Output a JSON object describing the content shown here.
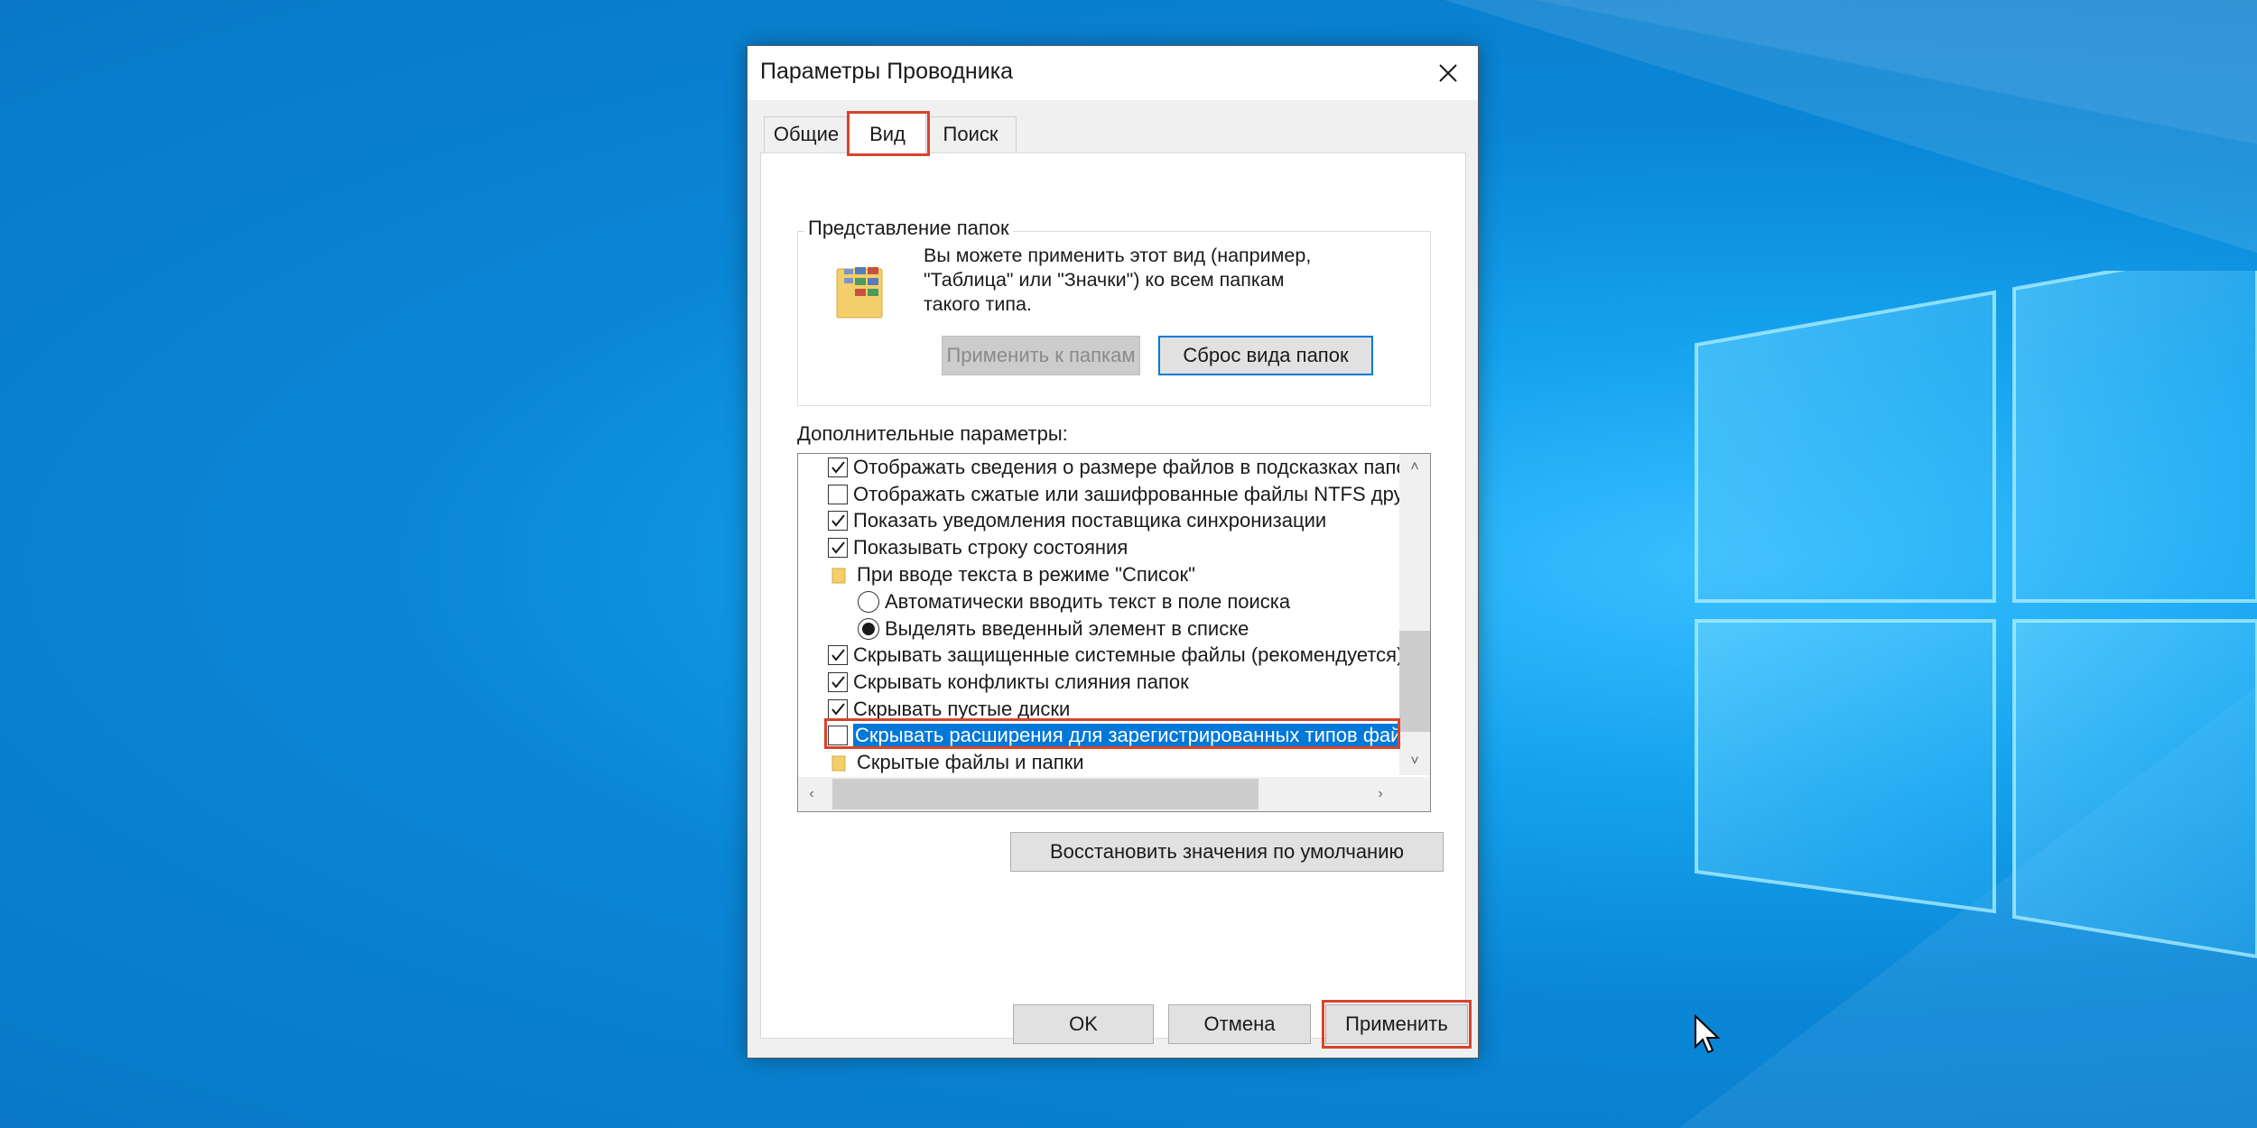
{
  "desktop": {
    "background_color": "#0a86d6",
    "accent_light": "#39c0ff"
  },
  "dialog": {
    "title": "Параметры Проводника",
    "close_icon": "close-icon"
  },
  "tabs": [
    {
      "label": "Общие",
      "active": false
    },
    {
      "label": "Вид",
      "active": true
    },
    {
      "label": "Поиск",
      "active": false
    }
  ],
  "folder_views": {
    "title": "Представление папок",
    "description": "Вы можете применить этот вид (например,\n\"Таблица\" или \"Значки\") ко всем папкам\nтакого типа.",
    "apply_button": "Применить к папкам",
    "reset_button": "Сброс вида папок",
    "icon": "folder-views-icon"
  },
  "advanced": {
    "label": "Дополнительные параметры:",
    "items": [
      {
        "type": "checkbox",
        "checked": true,
        "label": "Отображать сведения о размере файлов в подсказках папок"
      },
      {
        "type": "checkbox",
        "checked": false,
        "label": "Отображать сжатые или зашифрованные файлы NTFS другим цветом"
      },
      {
        "type": "checkbox",
        "checked": true,
        "label": "Показать уведомления поставщика синхронизации"
      },
      {
        "type": "checkbox",
        "checked": true,
        "label": "Показывать строку состояния"
      },
      {
        "type": "folder",
        "label": "При вводе текста в режиме \"Список\""
      },
      {
        "type": "radio",
        "checked": false,
        "label": "Автоматически вводить текст в поле поиска"
      },
      {
        "type": "radio",
        "checked": true,
        "label": "Выделять введенный элемент в списке"
      },
      {
        "type": "checkbox",
        "checked": true,
        "label": "Скрывать защищенные системные файлы (рекомендуется)"
      },
      {
        "type": "checkbox",
        "checked": true,
        "label": "Скрывать конфликты слияния папок"
      },
      {
        "type": "checkbox",
        "checked": true,
        "label": "Скрывать пустые диски"
      },
      {
        "type": "checkbox",
        "checked": false,
        "selected": true,
        "label": "Скрывать расширения для зарегистрированных типов файлов"
      },
      {
        "type": "folder",
        "label": "Скрытые файлы и папки"
      }
    ],
    "restore_button": "Восстановить значения по умолчанию"
  },
  "footer": {
    "ok": "OK",
    "cancel": "Отмена",
    "apply": "Применить"
  },
  "highlight_color": "#d8432c",
  "selection_color": "#0078d7"
}
